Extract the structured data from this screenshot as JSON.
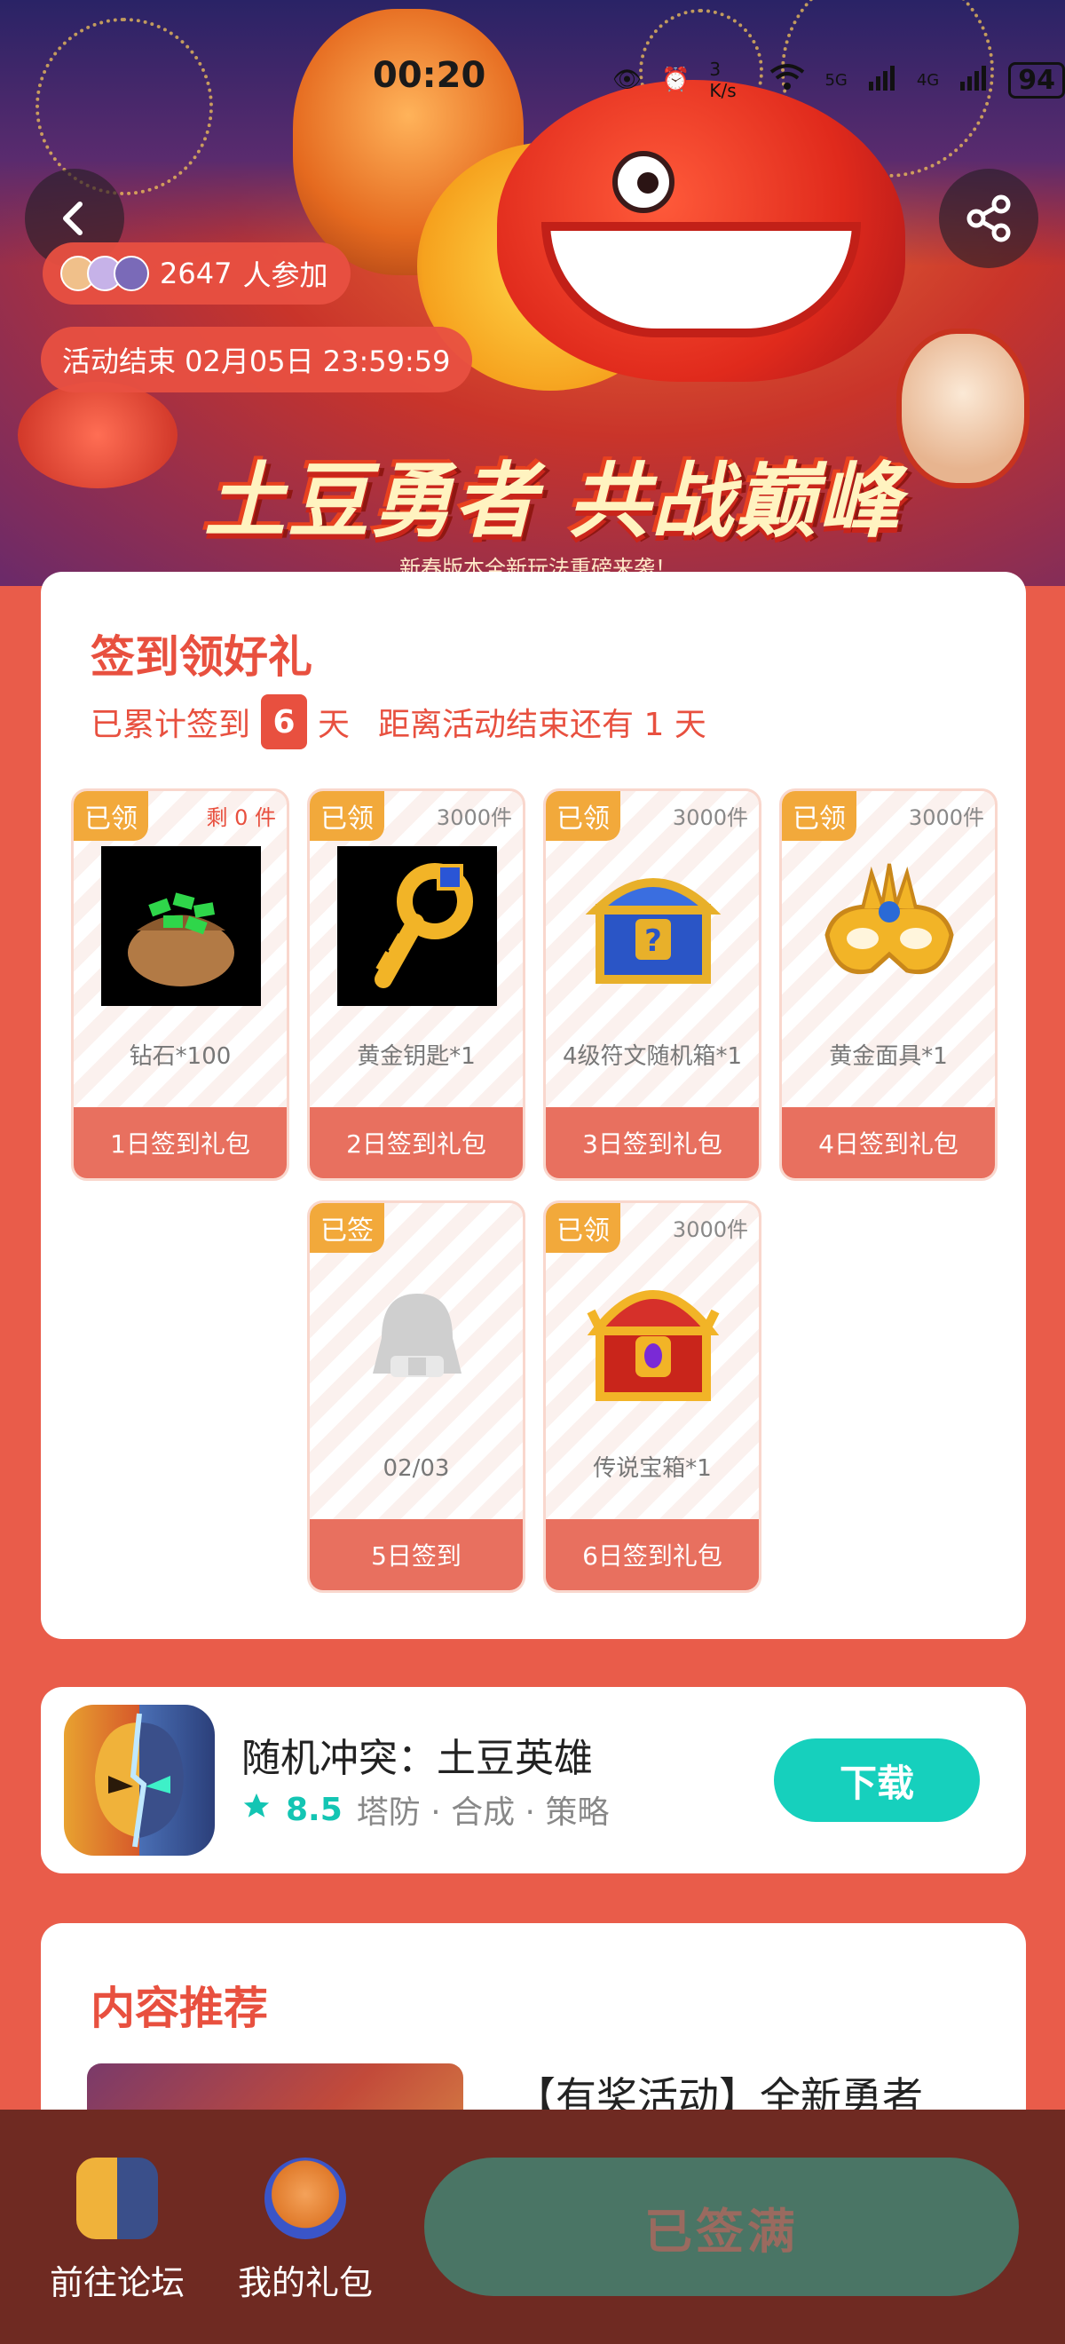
{
  "status_bar": {
    "time": "00:20",
    "net_speed": "3 K/s",
    "signal_5g": "5G",
    "signal_4g": "4G",
    "battery": "94"
  },
  "banner": {
    "title": "土豆勇者 共战巅峰",
    "subtitle": "新春版本全新玩法重磅来袭！"
  },
  "header": {
    "participants_count": "2647",
    "participants_suffix": "人参加",
    "ends_label": "活动结束 02月05日 23:59:59"
  },
  "signin": {
    "title": "签到领好礼",
    "streak_prefix": "已累计签到",
    "streak_days": "6",
    "streak_unit": "天",
    "remaining_text": "距离活动结束还有 1 天",
    "gifts": [
      {
        "tag": "已领",
        "stock": "剩 0 件",
        "name": "钻石*100",
        "footer": "1日签到礼包",
        "icon": "diamond-bag-icon"
      },
      {
        "tag": "已领",
        "stock": "3000件",
        "name": "黄金钥匙*1",
        "footer": "2日签到礼包",
        "icon": "golden-key-icon"
      },
      {
        "tag": "已领",
        "stock": "3000件",
        "name": "4级符文随机箱*1",
        "footer": "3日签到礼包",
        "icon": "rune-chest-icon"
      },
      {
        "tag": "已领",
        "stock": "3000件",
        "name": "黄金面具*1",
        "footer": "4日签到礼包",
        "icon": "golden-mask-icon"
      },
      {
        "tag": "已签",
        "stock": "",
        "name": "02/03",
        "footer": "5日签到",
        "icon": "placeholder-avatar-icon"
      },
      {
        "tag": "已领",
        "stock": "3000件",
        "name": "传说宝箱*1",
        "footer": "6日签到礼包",
        "icon": "legend-chest-icon"
      }
    ]
  },
  "game": {
    "name": "随机冲突：土豆英雄",
    "rating": "8.5",
    "tags": "塔防 · 合成 · 策略",
    "download_label": "下载"
  },
  "recommend": {
    "title": "内容推荐",
    "item_title": "【有奖活动】全新勇者"
  },
  "bottom_bar": {
    "forum_label": "前往论坛",
    "gifts_label": "我的礼包",
    "action_label": "已签满"
  },
  "colors": {
    "accent": "#e8503f",
    "tag": "#f2a93b",
    "download": "#16d0bd",
    "bottom": "#6f2a22",
    "action": "#4a7565"
  }
}
